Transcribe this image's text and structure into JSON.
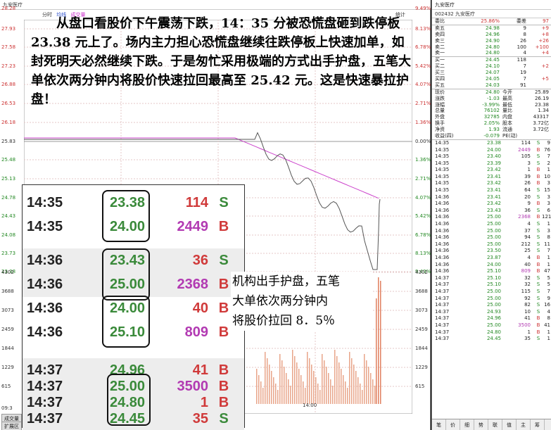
{
  "chart": {
    "title": "九安医疗",
    "legend": [
      "分时",
      "均线",
      "成交量"
    ],
    "left_axis": [
      "28.28",
      "27.93",
      "27.58",
      "27.23",
      "26.88",
      "26.53",
      "26.18",
      "25.83",
      "25.48",
      "25.13",
      "24.78",
      "24.43",
      "24.08",
      "23.73",
      "23.38",
      "4302",
      "3688",
      "3073",
      "2459",
      "1844",
      "1229",
      "615"
    ],
    "right_axis": [
      "9.49%",
      "8.13%",
      "6.78%",
      "5.42%",
      "4.07%",
      "2.71%",
      "1.36%",
      "0.00%",
      "1.36%",
      "2.71%",
      "4.07%",
      "5.42%",
      "6.78%",
      "8.13%",
      "9.49%",
      "4302",
      "3688",
      "3073",
      "2459",
      "1844",
      "1229",
      "615"
    ],
    "time_label": "14:00",
    "bottom_left": "09:3",
    "tabs": [
      "成交量",
      "扩展区"
    ],
    "stats_btn": "统计"
  },
  "annotation": "从盘口看股价下午震荡下跌，14：35 分被恐慌盘砸到跌停板 23.38 元上了。场内主力担心恐慌盘继续往跌停板上快速加单，如封死明天必然继续下跌。于是匆忙采用极端的方式出手护盘，五笔大单依次两分钟内将股价快速拉回最高至 25.42 元。这是快速暴拉护盘！",
  "callout": [
    "机构出手护盘，五笔",
    "大单依次两分钟内",
    "将股价拉回 8．5％"
  ],
  "zoom": [
    {
      "time": "14:35",
      "price": "23.38",
      "vol": "114",
      "side": "S",
      "vc": "c-red",
      "sc": "c-grn"
    },
    {
      "time": "14:35",
      "price": "24.00",
      "vol": "2449",
      "side": "B",
      "vc": "c-mag",
      "sc": "c-red"
    },
    {
      "time": "14:36",
      "price": "23.43",
      "vol": "36",
      "side": "S",
      "vc": "c-red",
      "sc": "c-grn"
    },
    {
      "time": "14:36",
      "price": "25.00",
      "vol": "2368",
      "side": "B",
      "vc": "c-mag",
      "sc": "c-red"
    },
    {
      "time": "14:36",
      "price": "24.00",
      "vol": "40",
      "side": "B",
      "vc": "c-red",
      "sc": "c-red"
    },
    {
      "time": "14:36",
      "price": "25.10",
      "vol": "809",
      "side": "B",
      "vc": "c-mag",
      "sc": "c-red"
    },
    {
      "time": "14:37",
      "price": "24.96",
      "vol": "41",
      "side": "B",
      "vc": "c-red",
      "sc": "c-red"
    },
    {
      "time": "14:37",
      "price": "25.00",
      "vol": "3500",
      "side": "B",
      "vc": "c-mag",
      "sc": "c-red"
    },
    {
      "time": "14:37",
      "price": "24.80",
      "vol": "1",
      "side": "B",
      "vc": "c-red",
      "sc": "c-red"
    },
    {
      "time": "14:37",
      "price": "24.45",
      "vol": "35",
      "side": "S",
      "vc": "c-red",
      "sc": "c-grn"
    }
  ],
  "quote": {
    "title": "九安医疗",
    "code": "002432 九安医疗",
    "weibi": {
      "label": "委比",
      "val": "25.86%",
      "label2": "委差",
      "val2": "97"
    },
    "asks": [
      {
        "label": "卖五",
        "price": "24.98",
        "vol": "9",
        "chg": "+9"
      },
      {
        "label": "卖四",
        "price": "24.96",
        "vol": "8",
        "chg": "+8"
      },
      {
        "label": "卖三",
        "price": "24.90",
        "vol": "26",
        "chg": "+26"
      },
      {
        "label": "卖二",
        "price": "24.80",
        "vol": "100",
        "chg": "+100"
      },
      {
        "label": "卖一",
        "price": "24.80",
        "vol": "4",
        "chg": "+4"
      }
    ],
    "bids": [
      {
        "label": "买一",
        "price": "24.45",
        "vol": "118",
        "chg": ""
      },
      {
        "label": "买二",
        "price": "24.10",
        "vol": "7",
        "chg": "+2"
      },
      {
        "label": "买三",
        "price": "24.07",
        "vol": "19",
        "chg": ""
      },
      {
        "label": "买四",
        "price": "24.05",
        "vol": "7",
        "chg": "+5"
      },
      {
        "label": "买五",
        "price": "24.03",
        "vol": "91",
        "chg": ""
      }
    ],
    "stats": [
      {
        "a": "现价",
        "b": "24.80",
        "c": "今开",
        "d": "25.89"
      },
      {
        "a": "涨跌",
        "b": "-1.03",
        "c": "最高",
        "d": "26.19"
      },
      {
        "a": "涨幅",
        "b": "-3.99%",
        "c": "最低",
        "d": "23.38"
      },
      {
        "a": "总量",
        "b": "76102",
        "c": "量比",
        "d": "1.34"
      },
      {
        "a": "外盘",
        "b": "32785",
        "c": "内盘",
        "d": "43317"
      },
      {
        "a": "换手",
        "b": "2.05%",
        "c": "股本",
        "d": "3.72亿"
      },
      {
        "a": "净资",
        "b": "1.93",
        "c": "流通",
        "d": "3.72亿"
      },
      {
        "a": "收益(四)",
        "b": "-0.079",
        "c": "PE(动)",
        "d": ""
      }
    ],
    "ticks": [
      {
        "t": "14:35",
        "p": "23.38",
        "v": "114",
        "s": "S",
        "n": "9"
      },
      {
        "t": "14:35",
        "p": "24.00",
        "v": "2449",
        "s": "B",
        "n": "76"
      },
      {
        "t": "14:35",
        "p": "23.40",
        "v": "105",
        "s": "S",
        "n": "7"
      },
      {
        "t": "14:35",
        "p": "23.39",
        "v": "3",
        "s": "S",
        "n": "2"
      },
      {
        "t": "14:35",
        "p": "23.42",
        "v": "1",
        "s": "B",
        "n": "1"
      },
      {
        "t": "14:35",
        "p": "23.41",
        "v": "39",
        "s": "B",
        "n": "10"
      },
      {
        "t": "14:35",
        "p": "23.42",
        "v": "26",
        "s": "B",
        "n": "3"
      },
      {
        "t": "14:35",
        "p": "23.41",
        "v": "64",
        "s": "S",
        "n": "15"
      },
      {
        "t": "14:36",
        "p": "23.41",
        "v": "20",
        "s": "S",
        "n": "3"
      },
      {
        "t": "14:36",
        "p": "23.42",
        "v": "9",
        "s": "B",
        "n": "3"
      },
      {
        "t": "14:36",
        "p": "23.43",
        "v": "36",
        "s": "S",
        "n": "6"
      },
      {
        "t": "14:36",
        "p": "25.00",
        "v": "2368",
        "s": "B",
        "n": "121"
      },
      {
        "t": "14:36",
        "p": "25.00",
        "v": "4",
        "s": "S",
        "n": "1"
      },
      {
        "t": "14:36",
        "p": "25.00",
        "v": "37",
        "s": "S",
        "n": "3"
      },
      {
        "t": "14:36",
        "p": "25.00",
        "v": "94",
        "s": "S",
        "n": "8"
      },
      {
        "t": "14:36",
        "p": "25.00",
        "v": "212",
        "s": "S",
        "n": "11"
      },
      {
        "t": "14:36",
        "p": "23.50",
        "v": "25",
        "s": "S",
        "n": "7"
      },
      {
        "t": "14:36",
        "p": "23.87",
        "v": "4",
        "s": "B",
        "n": "1"
      },
      {
        "t": "14:36",
        "p": "24.00",
        "v": "40",
        "s": "B",
        "n": "1"
      },
      {
        "t": "14:36",
        "p": "25.10",
        "v": "809",
        "s": "B",
        "n": "47"
      },
      {
        "t": "14:37",
        "p": "25.10",
        "v": "32",
        "s": "S",
        "n": "5"
      },
      {
        "t": "14:37",
        "p": "25.10",
        "v": "32",
        "s": "S",
        "n": "5"
      },
      {
        "t": "14:37",
        "p": "25.00",
        "v": "115",
        "s": "S",
        "n": "7"
      },
      {
        "t": "14:37",
        "p": "25.00",
        "v": "92",
        "s": "S",
        "n": "9"
      },
      {
        "t": "14:37",
        "p": "25.00",
        "v": "82",
        "s": "S",
        "n": "16"
      },
      {
        "t": "14:37",
        "p": "24.93",
        "v": "10",
        "s": "S",
        "n": "4"
      },
      {
        "t": "14:37",
        "p": "24.96",
        "v": "41",
        "s": "B",
        "n": "8"
      },
      {
        "t": "14:37",
        "p": "25.00",
        "v": "3500",
        "s": "B",
        "n": "41"
      },
      {
        "t": "14:37",
        "p": "24.80",
        "v": "1",
        "s": "B",
        "n": "1"
      },
      {
        "t": "14:37",
        "p": "24.45",
        "v": "35",
        "s": "S",
        "n": "1"
      }
    ],
    "bottom_tabs": [
      "笔",
      "价",
      "细",
      "势",
      "联",
      "值",
      "主",
      "筹"
    ]
  }
}
